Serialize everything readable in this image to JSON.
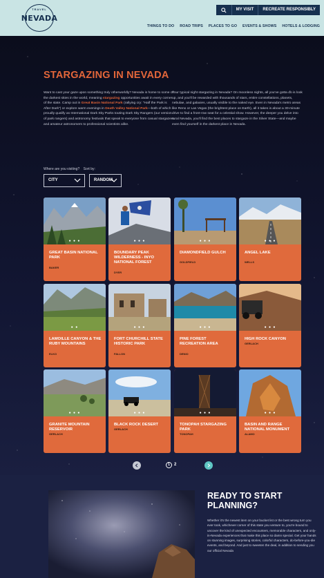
{
  "header": {
    "logo_top": "TRAVEL",
    "logo_name": "NEVADA",
    "topbar": {
      "my_visit": "MY VISIT",
      "recreate": "RECREATE RESPONSIBLY"
    },
    "nav": [
      "THINGS TO DO",
      "ROAD TRIPS",
      "PLACES TO GO",
      "EVENTS & SHOWS",
      "HOTELS & LODGING"
    ]
  },
  "intro": {
    "title": "STARGAZING IN NEVADA",
    "col1": {
      "p1": "Want to cast your gaze upon something truly otherworldly? Nevada is home to some of the darkest skies in the world, meaning ",
      "l1": "stargazing",
      "p2": " opportunities await in every corner of the state. Camp out in ",
      "l2": "Great Basin National Park",
      "p3": " (rallying cry: \"Half the Park is After Dark\") or explore warm evenings in ",
      "l3": "Death Valley National Park",
      "p4": "—both of which proudly qualify as International Dark Sky Parks touting Dark Sky Rangers (our version of park rangers) and astronomy festivals that speak to everyone from casual stargazers and amateur astronomers to professional scientists alike."
    },
    "col2": "Your typical night stargazing in Nevada? On moonless nights, all you've gotta do is look up, and you'll be rewarded with thousands of stars, entire constellations, planets, nebulae, and galaxies, usually visible to the naked eye. Even in Nevada's metro areas like Reno or Las Vegas (the brightest place on Earth), all it takes is about a 30-minute drive to find a front-row seat for a celestial show. However, the deeper you delve into rural Nevada, you'll find the best places to stargaze in the Silver State—and maybe even find yourself in the darkest place in Nevada."
  },
  "filters": {
    "visiting_label": "Where are you visiting?",
    "sort_label": "Sort by:",
    "visiting_value": "CITY",
    "sort_value": "RANDOM"
  },
  "cards": [
    {
      "name": "GREAT BASIN NATIONAL PARK",
      "location": "BAKER"
    },
    {
      "name": "BOUNDARY PEAK WILDERNESS - INYO NATIONAL FOREST",
      "location": "DYER"
    },
    {
      "name": "DIAMONDFIELD GULCH",
      "location": "GOLDFIELD"
    },
    {
      "name": "ANGEL LAKE",
      "location": "WELLS"
    },
    {
      "name": "LAMOILLE CANYON & THE RUBY MOUNTAINS",
      "location": "ELKO"
    },
    {
      "name": "FORT CHURCHILL STATE HISTORIC PARK",
      "location": "FALLON"
    },
    {
      "name": "PINE FOREST RECREATION AREA",
      "location": "DENIO"
    },
    {
      "name": "HIGH ROCK CANYON",
      "location": "GERLACH"
    },
    {
      "name": "GRANITE MOUNTAIN RESERVOIR",
      "location": "GERLACH"
    },
    {
      "name": "BLACK ROCK DESERT",
      "location": "GERLACH"
    },
    {
      "name": "TONOPAH STARGAZING PARK",
      "location": "TONOPAH"
    },
    {
      "name": "BASIN AND RANGE NATIONAL MONUMENT",
      "location": "ALAMO"
    }
  ],
  "pagination": {
    "current": "1",
    "next": "2"
  },
  "plan": {
    "title": "READY TO START PLANNING?",
    "text": "Whether it's the newest item on your bucket list or the best wrong turn you ever took, whichever corner of this state you venture to, you're bound to uncover the kind of unexpected encounters, memorable characters, and only-in-Nevada experiences that make this place so damn special. Get your hands on stunning images, surprising stories, colorful characters, do-before-you-die events, and beyond. And just to sweeten the deal, in addition to sending you our official Nevada"
  },
  "colors": {
    "accent": "#e3663a",
    "header_bg": "#c9e4e4",
    "page_bg": "#0f1226",
    "navy": "#16304f",
    "card": "#e06a3c"
  }
}
